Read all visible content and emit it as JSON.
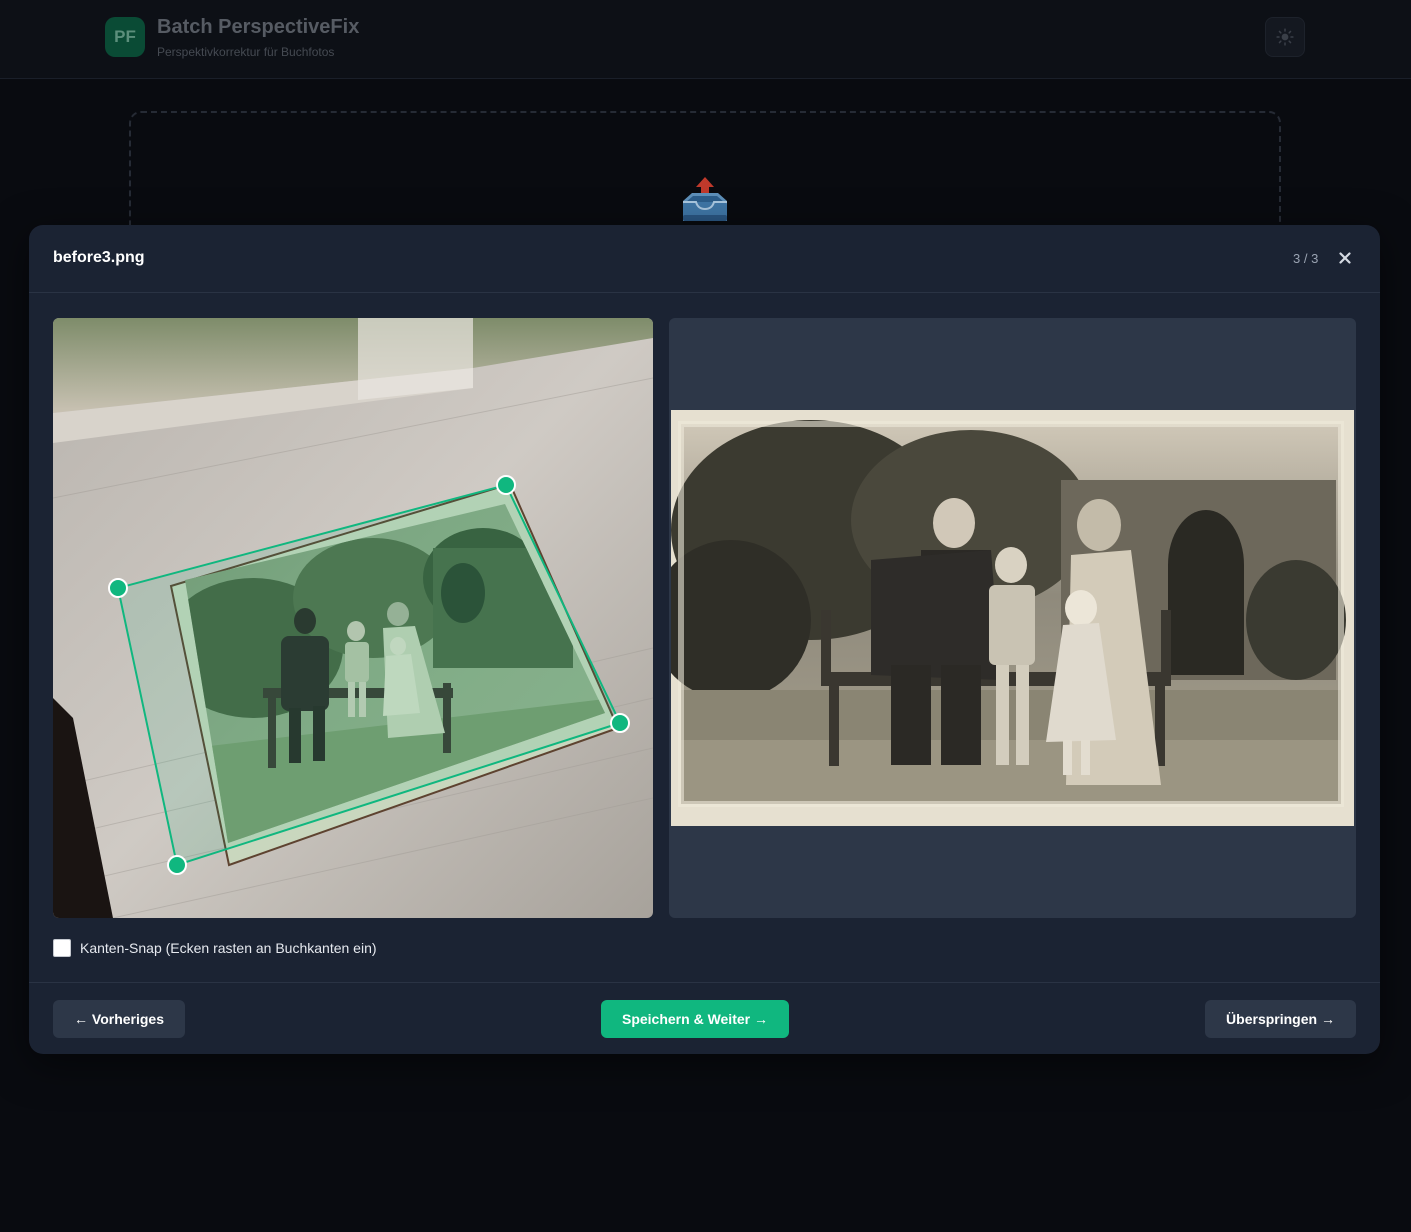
{
  "app": {
    "logo": "PF",
    "title": "Batch PerspectiveFix",
    "subtitle": "Perspektivkorrektur für Buchfotos",
    "theme_icon": "sun-icon"
  },
  "dropzone": {
    "icon": "inbox-upload-icon"
  },
  "modal": {
    "filename": "before3.png",
    "counter": "3 / 3",
    "close_icon": "close-icon",
    "snap_label": "Kanten-Snap (Ecken rasten an Buchkanten ein)",
    "snap_checked": false,
    "buttons": {
      "previous": "← Vorheriges",
      "save_next": "Speichern & Weiter →",
      "skip": "Überspringen →"
    }
  },
  "colors": {
    "accent": "#10b77f",
    "modal_bg": "#1b2333",
    "panel_bg": "#2d3748",
    "page_bg": "#090b10"
  }
}
